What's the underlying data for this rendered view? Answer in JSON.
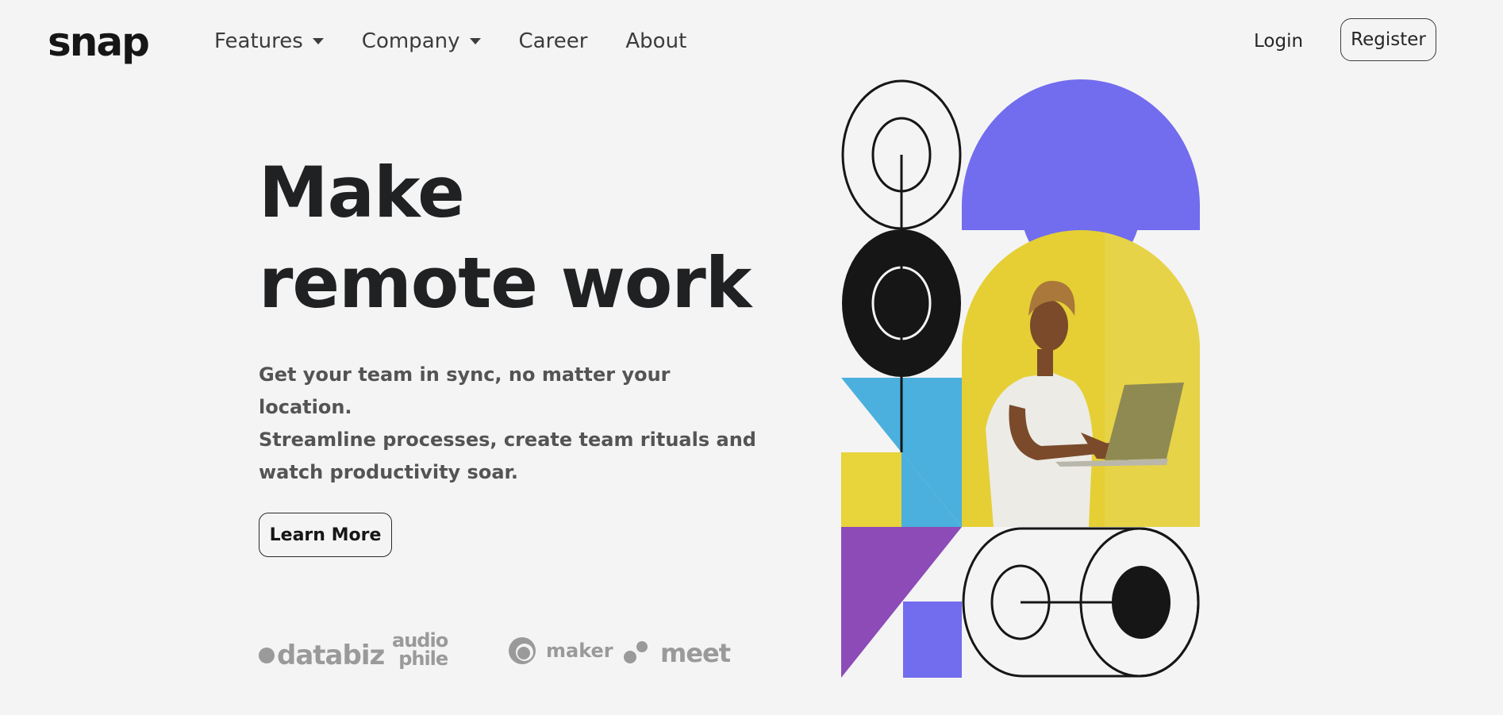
{
  "brand": {
    "logo_text": "snap"
  },
  "nav": {
    "items": [
      {
        "label": "Features",
        "has_dropdown": true
      },
      {
        "label": "Company",
        "has_dropdown": true
      },
      {
        "label": "Career",
        "has_dropdown": false
      },
      {
        "label": "About",
        "has_dropdown": false
      }
    ],
    "login_label": "Login",
    "register_label": "Register"
  },
  "hero": {
    "title_line1": "Make",
    "title_line2": "remote work",
    "subtitle_line1": "Get your team in sync, no matter your location.",
    "subtitle_line2": "Streamline processes, create team rituals and",
    "subtitle_line3": "watch productivity soar.",
    "cta_label": "Learn More"
  },
  "clients": {
    "databiz": "databiz",
    "audiophile_line1": "audio",
    "audiophile_line2": "phile",
    "maker": "maker",
    "meet": "meet"
  },
  "colors": {
    "background": "#f4f4f4",
    "text_dark": "#161616",
    "violet": "#726cee",
    "yellow": "#e8d43b",
    "cyan": "#4bb0dd",
    "purple": "#8c4bb7",
    "muted": "#9a9a9a"
  },
  "icons": [
    "caret-down-icon",
    "caret-down-icon",
    "databiz-logo-icon",
    "maker-logo-icon",
    "meet-logo-icon"
  ]
}
